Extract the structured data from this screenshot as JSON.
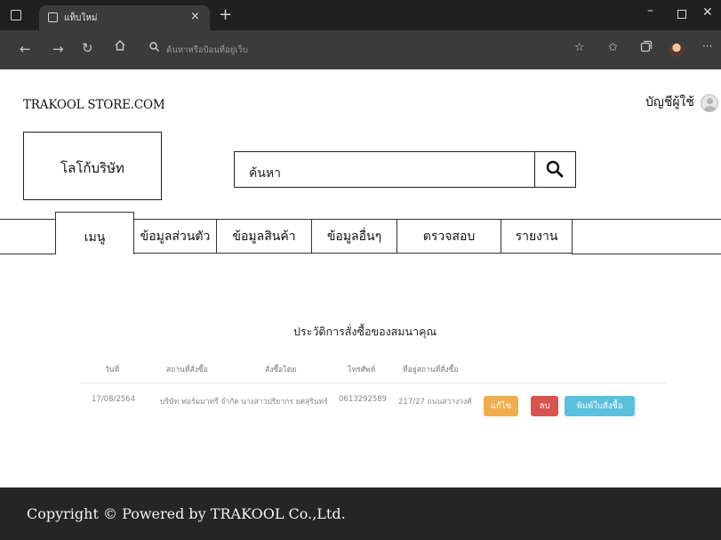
{
  "browser": {
    "tab_title": "แท็บใหม่",
    "tab_close": "×",
    "new_tab": "+",
    "address_placeholder": "ค้นหาหรือป้อนที่อยู่เว็บ",
    "window_controls": {
      "minimize": "–",
      "close": "✕"
    },
    "icons": [
      "back-icon",
      "forward-icon",
      "refresh-icon",
      "home-icon",
      "search-icon",
      "favorites-add-icon",
      "favorites-icon",
      "collections-icon",
      "profile-icon",
      "more-icon"
    ]
  },
  "header": {
    "site_name": "TRAKOOL STORE.COM",
    "account_label": "บัญชีผู้ใช้"
  },
  "logo": {
    "text": "โลโก้บริษัท"
  },
  "search": {
    "text": "ค้นหา"
  },
  "nav": {
    "items": [
      {
        "label": "เมนู"
      },
      {
        "label": "ข้อมูลส่วนตัว"
      },
      {
        "label": "ข้อมูลสินค้า"
      },
      {
        "label": "ข้อมูลอื่นๆ"
      },
      {
        "label": "ตรวจสอบ"
      },
      {
        "label": "รายงาน"
      }
    ]
  },
  "history": {
    "title": "ประวัติการสั่งซื้อของสมนาคุณ",
    "columns": [
      "วันที่",
      "สถานที่สั่งซื้อ",
      "สั่งซื้อโดย",
      "โทรศัพท์",
      "ที่อยู่สถานที่สั่งซื้อ"
    ],
    "rows": [
      {
        "date": "17/08/2564",
        "place": "บริษัท ฟอร์มมาทรี จำกัด",
        "ordered_by": "นางสาวปริยากร ยศสุรินทร์",
        "phone": "0613292589",
        "address": "217/27 ถนนสว่างวงศ์"
      }
    ],
    "actions": {
      "edit": "แก้ไข",
      "delete": "ลบ",
      "print": "พิมพ์ใบสั่งซื้อ"
    },
    "colors": {
      "edit": "#f0ad4e",
      "delete": "#d9534f",
      "print": "#5bc0de"
    }
  },
  "footer": {
    "text": "Copyright © Powered by TRAKOOL Co.,Ltd."
  }
}
